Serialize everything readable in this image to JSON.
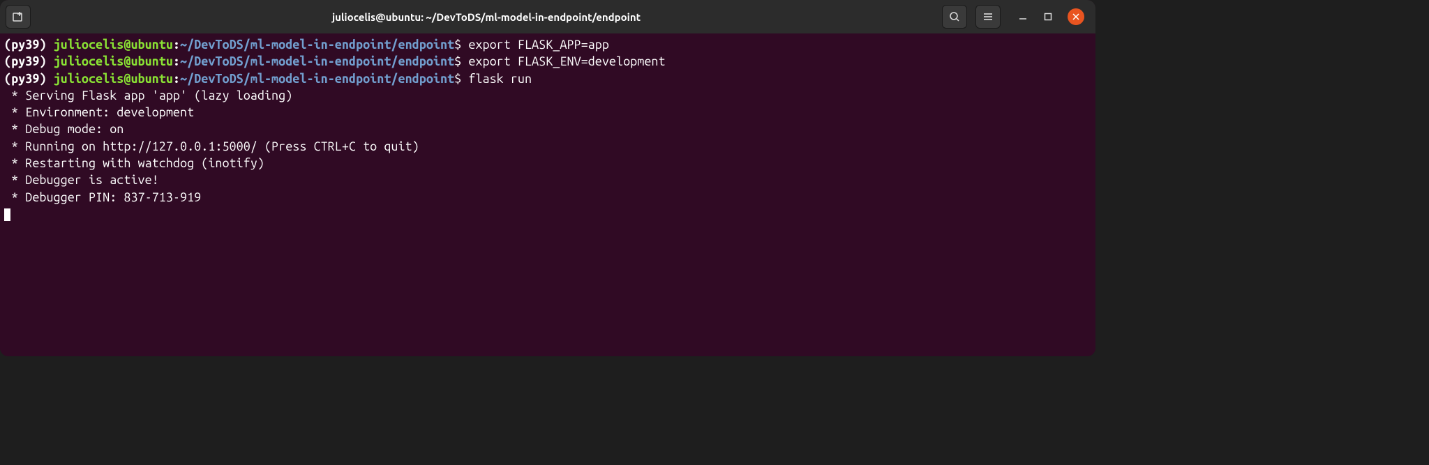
{
  "window": {
    "title": "juliocelis@ubuntu: ~/DevToDS/ml-model-in-endpoint/endpoint"
  },
  "prompt": {
    "venv": "(py39) ",
    "user_host": "juliocelis@ubuntu",
    "colon": ":",
    "path": "~/DevToDS/ml-model-in-endpoint/endpoint",
    "dollar": "$"
  },
  "commands": {
    "c1": "export FLASK_APP=app",
    "c2": "export FLASK_ENV=development",
    "c3": "flask run"
  },
  "output": {
    "l1": " * Serving Flask app 'app' (lazy loading)",
    "l2": " * Environment: development",
    "l3": " * Debug mode: on",
    "l4": " * Running on http://127.0.0.1:5000/ (Press CTRL+C to quit)",
    "l5": " * Restarting with watchdog (inotify)",
    "l6": " * Debugger is active!",
    "l7": " * Debugger PIN: 837-713-919"
  }
}
